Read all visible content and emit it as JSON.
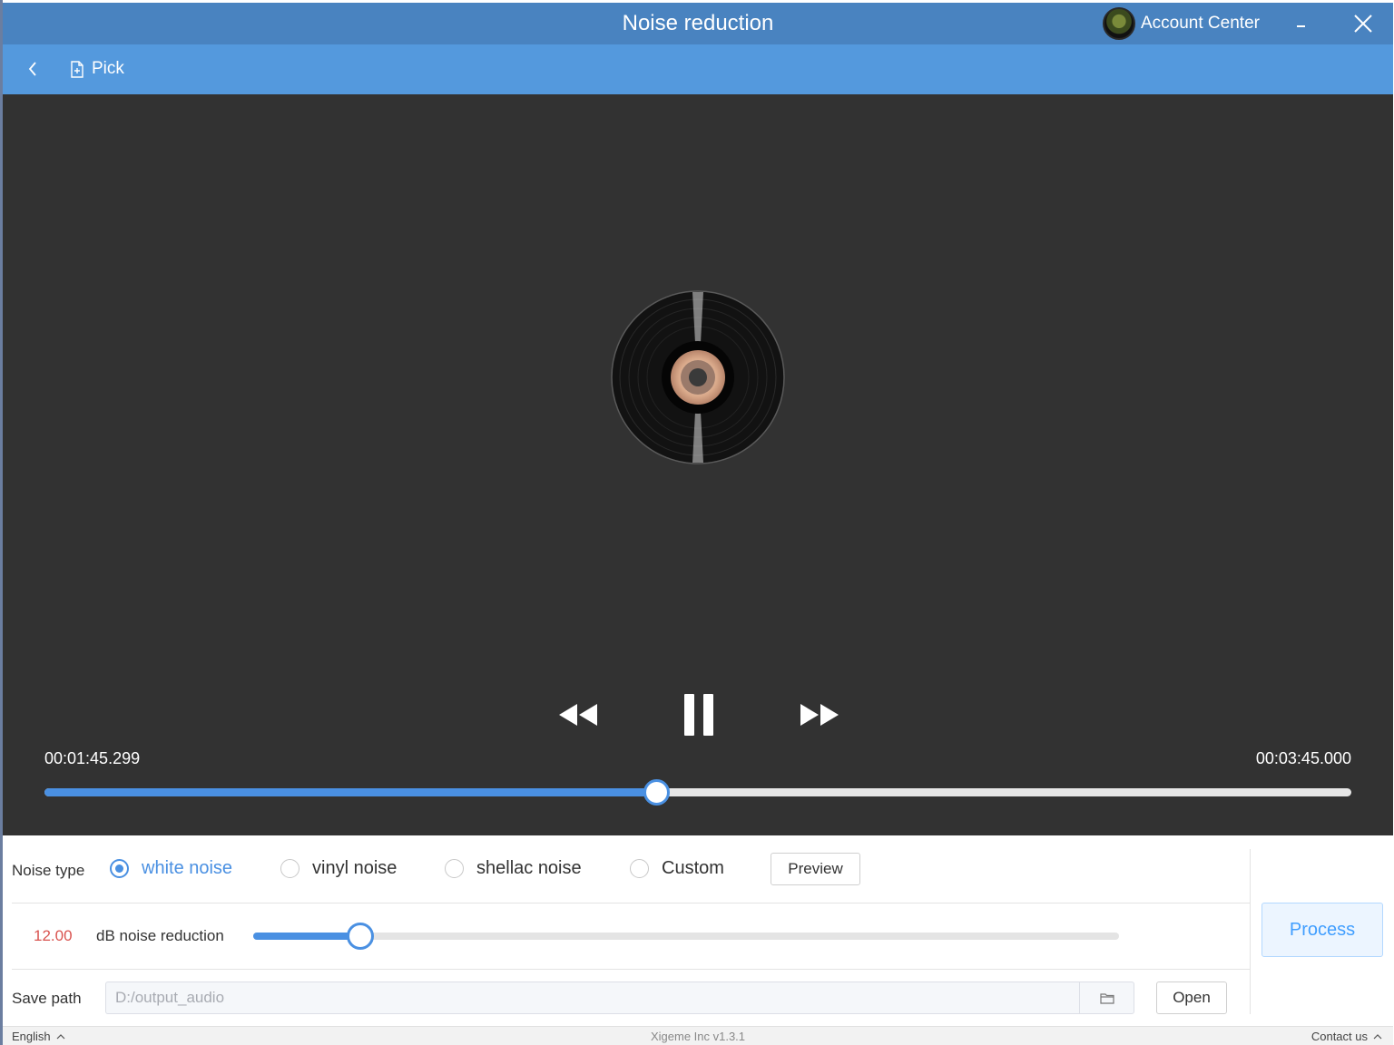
{
  "window": {
    "title": "Noise reduction"
  },
  "account": {
    "label": "Account Center",
    "avatar_icon": "user-avatar"
  },
  "toolbar": {
    "back_icon": "chevron-left-icon",
    "pick_label": "Pick",
    "pick_icon": "file-add-icon"
  },
  "player": {
    "current_time": "00:01:45.299",
    "total_time": "00:03:45.000",
    "progress_fraction": 0.468,
    "state": "playing"
  },
  "settings": {
    "noise_type_label": "Noise type",
    "noise_options": [
      {
        "label": "white noise",
        "selected": true
      },
      {
        "label": "vinyl noise",
        "selected": false
      },
      {
        "label": "shellac noise",
        "selected": false
      },
      {
        "label": "Custom",
        "selected": false
      }
    ],
    "preview_label": "Preview",
    "db_value": "12.00",
    "db_label": "dB noise reduction",
    "db_fraction": 0.124,
    "save_path_label": "Save path",
    "save_path_value": "D:/output_audio",
    "open_label": "Open",
    "process_label": "Process"
  },
  "statusbar": {
    "language": "English",
    "version": "Xigeme Inc v1.3.1",
    "contact": "Contact us"
  },
  "colors": {
    "titlebar": "#4983c0",
    "toolbar": "#5499dd",
    "accent": "#4a90e2",
    "player_bg": "#323232",
    "db_value": "#d9534f"
  }
}
